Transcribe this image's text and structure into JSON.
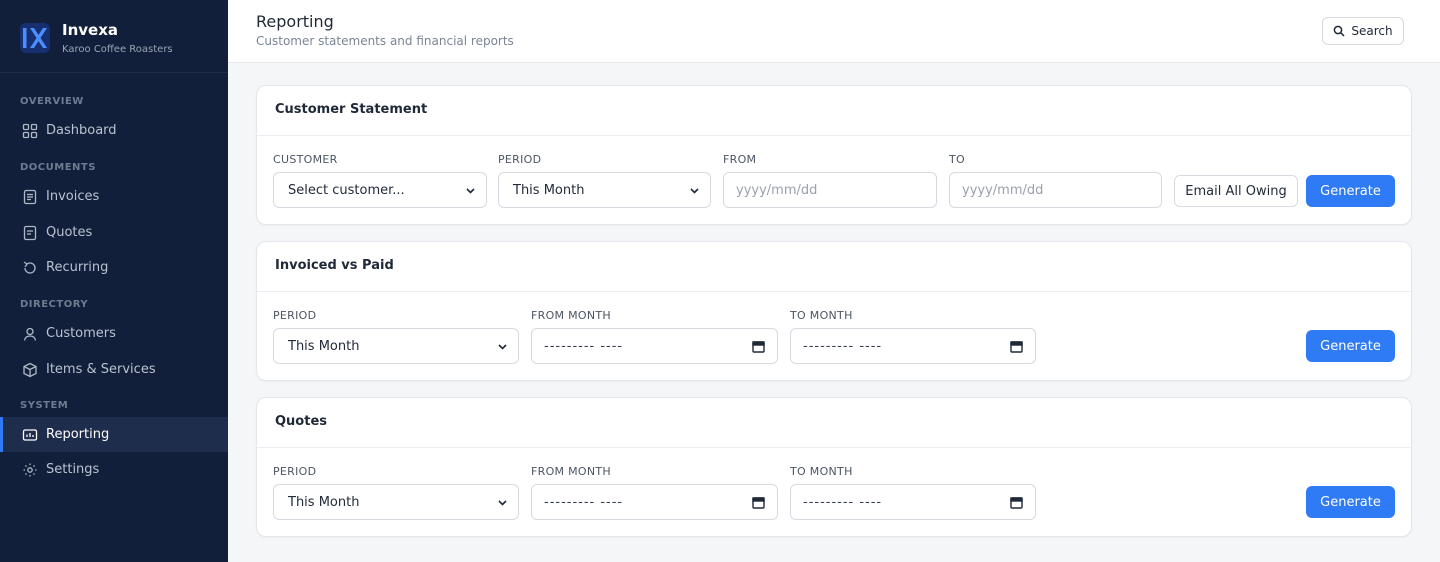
{
  "brand": {
    "name": "Invexa",
    "subtitle": "Karoo Coffee Roasters"
  },
  "sidebar": {
    "sections": [
      {
        "label": "OVERVIEW"
      },
      {
        "label": "DOCUMENTS"
      },
      {
        "label": "DIRECTORY"
      },
      {
        "label": "SYSTEM"
      }
    ],
    "items": [
      {
        "label": "Dashboard",
        "icon": "grid-icon"
      },
      {
        "label": "Invoices",
        "icon": "document-icon"
      },
      {
        "label": "Quotes",
        "icon": "quote-document-icon"
      },
      {
        "label": "Recurring",
        "icon": "refresh-icon"
      },
      {
        "label": "Customers",
        "icon": "user-icon"
      },
      {
        "label": "Items & Services",
        "icon": "box-icon"
      },
      {
        "label": "Reporting",
        "icon": "report-icon",
        "active": true
      },
      {
        "label": "Settings",
        "icon": "gear-icon"
      }
    ]
  },
  "header": {
    "title": "Reporting",
    "subtitle": "Customer statements and financial reports",
    "search_label": "Search"
  },
  "customer_statement": {
    "title": "Customer Statement",
    "customer_label": "CUSTOMER",
    "customer_value": "Select customer...",
    "period_label": "PERIOD",
    "period_value": "This Month",
    "from_label": "FROM",
    "from_placeholder": "yyyy/mm/dd",
    "to_label": "TO",
    "to_placeholder": "yyyy/mm/dd",
    "email_button": "Email All Owing",
    "generate_button": "Generate"
  },
  "invoiced_vs_paid": {
    "title": "Invoiced vs Paid",
    "period_label": "PERIOD",
    "period_value": "This Month",
    "from_label": "FROM MONTH",
    "from_value": "--------- ----",
    "to_label": "TO MONTH",
    "to_value": "--------- ----",
    "generate_button": "Generate"
  },
  "quotes": {
    "title": "Quotes",
    "period_label": "PERIOD",
    "period_value": "This Month",
    "from_label": "FROM MONTH",
    "from_value": "--------- ----",
    "to_label": "TO MONTH",
    "to_value": "--------- ----",
    "generate_button": "Generate"
  },
  "colors": {
    "sidebar_bg": "#121f3a",
    "accent": "#2f7bf6",
    "page_bg": "#f5f6f8"
  }
}
